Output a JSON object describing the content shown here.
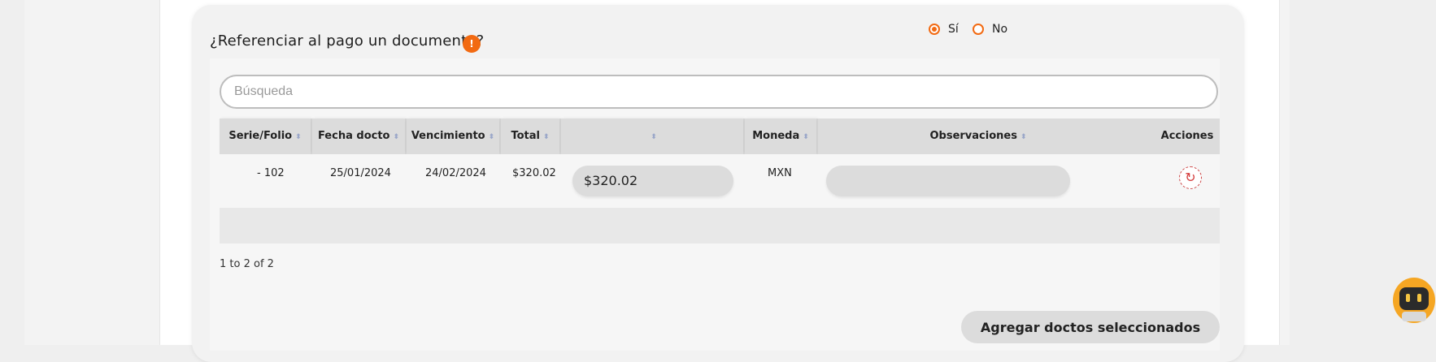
{
  "form": {
    "question": "¿Referenciar al pago un documento?",
    "info_icon": "!",
    "radio_yes": "Sí",
    "radio_no": "No",
    "selected": "Sí"
  },
  "search": {
    "placeholder": "Búsqueda"
  },
  "table": {
    "columns": [
      "Serie/Folio",
      "Fecha docto",
      "Vencimiento",
      "Total",
      "",
      "Moneda",
      "Observaciones",
      "Acciones"
    ],
    "rows": [
      {
        "serie_folio": "- 102",
        "fecha_docto": "25/01/2024",
        "vencimiento": "24/02/2024",
        "total": "$320.02",
        "amount_input": "$320.02",
        "moneda": "MXN",
        "observaciones": ""
      }
    ]
  },
  "pagination": {
    "text": "1 to 2 of 2"
  },
  "buttons": {
    "add_selected": "Agregar doctos seleccionados"
  },
  "colors": {
    "accent": "#f26a12",
    "refresh_icon": "#d43b3b"
  },
  "icons": {
    "info": "exclamation-icon",
    "sort": "sort-icon",
    "refresh": "refresh-icon",
    "assistant": "robot-assistant-icon"
  }
}
